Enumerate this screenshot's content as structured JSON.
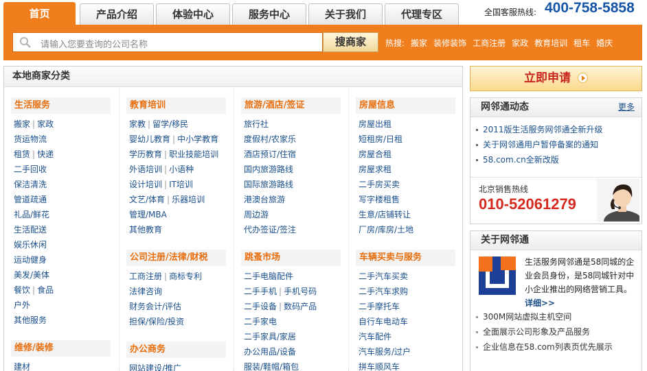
{
  "nav": {
    "tabs": [
      "首页",
      "产品介绍",
      "体验中心",
      "服务中心",
      "关于我们",
      "代理专区"
    ],
    "hotline_label": "全国客服热线:",
    "hotline_number": "400-758-5858"
  },
  "search": {
    "placeholder": "请输入您要查询的公司名称",
    "button": "搜商家",
    "hot_label": "热搜:",
    "hot_terms": [
      "搬家",
      "装修装饰",
      "工商注册",
      "家政",
      "教育培训",
      "租车",
      "婚庆"
    ]
  },
  "categories": {
    "title": "本地商家分类",
    "columns": [
      [
        {
          "name": "生活服务",
          "rows": [
            [
              "搬家",
              "家政"
            ],
            [
              "货运物流"
            ],
            [
              "租赁",
              "快递"
            ],
            [
              "二手回收"
            ],
            [
              "保洁清洗"
            ],
            [
              "管道疏通"
            ],
            [
              "礼品/鲜花"
            ],
            [
              "生活配送"
            ],
            [
              "娱乐休闲"
            ],
            [
              "运动健身"
            ],
            [
              "美发/美体"
            ],
            [
              "餐饮",
              "食品"
            ],
            [
              "户外"
            ],
            [
              "其他服务"
            ]
          ]
        },
        {
          "name": "维修/装修",
          "rows": [
            [
              "建材"
            ]
          ]
        }
      ],
      [
        {
          "name": "教育培训",
          "rows": [
            [
              "家教",
              "留学/移民"
            ],
            [
              "婴幼儿教育",
              "中小学教育"
            ],
            [
              "学历教育",
              "职业技能培训"
            ],
            [
              "外语培训",
              "小语种"
            ],
            [
              "设计培训",
              "IT培训"
            ],
            [
              "文艺/体育",
              "乐器培训"
            ],
            [
              "管理/MBA"
            ],
            [
              "其他教育"
            ]
          ]
        },
        {
          "name": "公司注册/法律/财税",
          "rows": [
            [
              "工商注册",
              "商标专利"
            ],
            [
              "法律咨询"
            ],
            [
              "财务会计/评估"
            ],
            [
              "担保/保险/投资"
            ]
          ]
        },
        {
          "name": "办公商务",
          "rows": [
            [
              "网站建设/推广"
            ]
          ]
        }
      ],
      [
        {
          "name": "旅游/酒店/签证",
          "rows": [
            [
              "旅行社"
            ],
            [
              "度假村/农家乐"
            ],
            [
              "酒店预订/住宿"
            ],
            [
              "国内旅游路线"
            ],
            [
              "国际旅游路线"
            ],
            [
              "港澳台旅游"
            ],
            [
              "周边游"
            ],
            [
              "代办签证/签注"
            ]
          ]
        },
        {
          "name": "跳蚤市场",
          "rows": [
            [
              "二手电脑配件"
            ],
            [
              "二手手机",
              "手机号码"
            ],
            [
              "二手设备",
              "数码产品"
            ],
            [
              "二手家电"
            ],
            [
              "二手家具/家居"
            ],
            [
              "办公用品/设备"
            ],
            [
              "服装/鞋帽/箱包"
            ]
          ]
        }
      ],
      [
        {
          "name": "房屋信息",
          "rows": [
            [
              "房屋出租"
            ],
            [
              "短租房/日租"
            ],
            [
              "房屋合租"
            ],
            [
              "房屋求租"
            ],
            [
              "二手房买卖"
            ],
            [
              "写字楼租售"
            ],
            [
              "生意/店铺转让"
            ],
            [
              "厂房/库房/土地"
            ]
          ]
        },
        {
          "name": "车辆买卖与服务",
          "rows": [
            [
              "二手汽车买卖"
            ],
            [
              "二手汽车求购"
            ],
            [
              "二手摩托车"
            ],
            [
              "自行车电动车"
            ],
            [
              "汽车配件"
            ],
            [
              "汽车服务/过户"
            ],
            [
              "拼车顺风车"
            ]
          ]
        }
      ]
    ]
  },
  "apply_button": "立即申请",
  "news": {
    "title": "网邻通动态",
    "more": "更多",
    "items": [
      "2011版生活服务网邻通全新升级",
      "关于网邻通用户暂停备案的通知",
      "58.com.cn全新改版"
    ]
  },
  "sales": {
    "label": "北京销售热线",
    "number": "010-52061279"
  },
  "about": {
    "title": "关于网邻通",
    "text": "生活服务网邻通是58同城的企业会员身份，是58同城针对中小企业推出的网络营销工具。",
    "more": "详细>>",
    "items": [
      "300M网站虚拟主机空间",
      "全面展示公司形象及产品服务",
      "企业信息在58.com列表页优先展示"
    ]
  },
  "colors": {
    "accent_orange": "#f07e1d",
    "link_blue": "#1a4f8b",
    "hotline_blue": "#1655a6",
    "sales_red": "#d6291f",
    "category_orange": "#e86e0e"
  }
}
